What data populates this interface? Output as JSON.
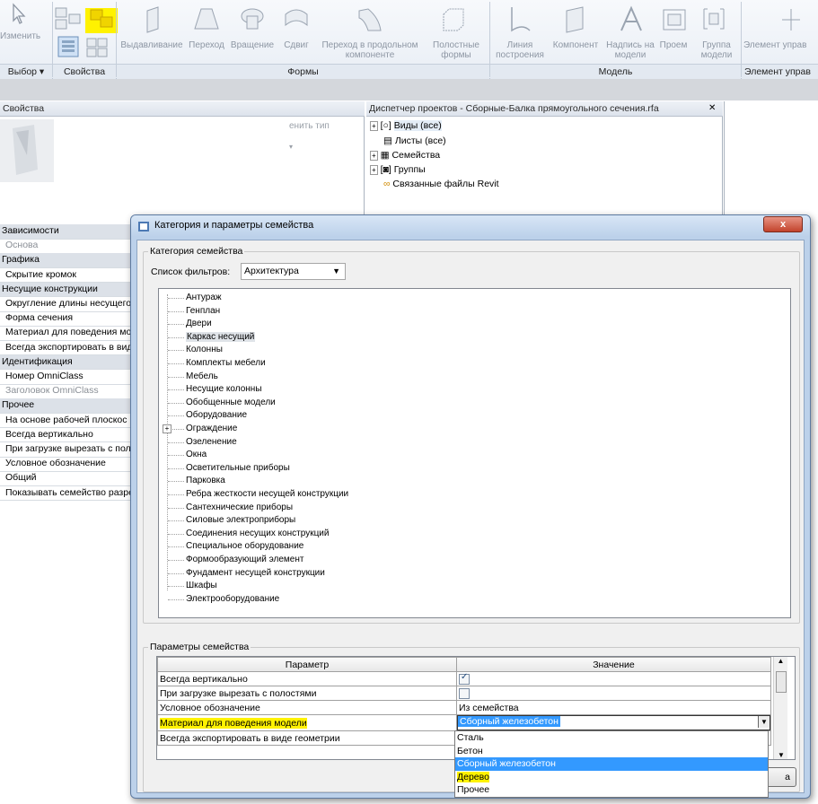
{
  "ribbon": {
    "modify_label": "Изменить",
    "select_label": "Выбор",
    "properties_label": "Свойства",
    "forms_panel": "Формы",
    "model_panel": "Модель",
    "control_panel": "Элемент управ",
    "tools": [
      {
        "label": "Выдавливание"
      },
      {
        "label": "Переход"
      },
      {
        "label": "Вращение"
      },
      {
        "label": "Сдвиг"
      },
      {
        "label": "Переход в продольном компоненте"
      },
      {
        "label": "Полостные формы"
      },
      {
        "label": "Линия построения"
      },
      {
        "label": "Компонент"
      },
      {
        "label": "Надпись на модели"
      },
      {
        "label": "Проем"
      },
      {
        "label": "Группа модели"
      },
      {
        "label": "Элемент управ"
      }
    ]
  },
  "properties": {
    "title": "Свойства",
    "change_type": "енить тип",
    "rows": [
      {
        "text": "Зависимости",
        "kind": "cat"
      },
      {
        "text": "Основа",
        "kind": "dis"
      },
      {
        "text": "Графика",
        "kind": "cat"
      },
      {
        "text": "Скрытие кромок",
        "kind": "row"
      },
      {
        "text": "Несущие конструкции",
        "kind": "cat"
      },
      {
        "text": "Округление длины несущего",
        "kind": "row"
      },
      {
        "text": "Форма сечения",
        "kind": "row"
      },
      {
        "text": "Материал для поведения мо",
        "kind": "row"
      },
      {
        "text": "Всегда экспортировать в вид",
        "kind": "row"
      },
      {
        "text": "Идентификация",
        "kind": "cat"
      },
      {
        "text": "Номер OmniClass",
        "kind": "row"
      },
      {
        "text": "Заголовок OmniClass",
        "kind": "dis"
      },
      {
        "text": "Прочее",
        "kind": "cat"
      },
      {
        "text": "На основе рабочей плоскос",
        "kind": "row"
      },
      {
        "text": "Всегда вертикально",
        "kind": "row"
      },
      {
        "text": "При загрузке вырезать с пол",
        "kind": "row"
      },
      {
        "text": "Условное обозначение",
        "kind": "row"
      },
      {
        "text": "Общий",
        "kind": "row"
      },
      {
        "text": "Показывать семейство разре",
        "kind": "row"
      }
    ]
  },
  "project_browser": {
    "title": "Диспетчер проектов - Сборные-Балка прямоугольного сечения.rfa",
    "close": "✕",
    "items": [
      "Виды (все)",
      "Листы (все)",
      "Семейства",
      "Группы",
      "Связанные файлы Revit"
    ]
  },
  "dialog": {
    "title": "Категория и параметры семейства",
    "close": "x",
    "category_group": "Категория семейства",
    "filter_label": "Список фильтров:",
    "filter_value": "Архитектура",
    "categories": [
      "Антураж",
      "Генплан",
      "Двери",
      "Каркас несущий",
      "Колонны",
      "Комплекты мебели",
      "Мебель",
      "Несущие колонны",
      "Обобщенные модели",
      "Оборудование",
      "Ограждение",
      "Озеленение",
      "Окна",
      "Осветительные приборы",
      "Парковка",
      "Ребра жесткости несущей конструкции",
      "Сантехнические приборы",
      "Силовые электроприборы",
      "Соединения несущих конструкций",
      "Специальное оборудование",
      "Формообразующий элемент",
      "Фундамент несущей конструкции",
      "Шкафы",
      "Электрооборудование"
    ],
    "selected_category": "Каркас несущий",
    "params_group": "Параметры семейства",
    "col_param": "Параметр",
    "col_value": "Значение",
    "params": [
      {
        "name": "Всегда вертикально",
        "value": "",
        "checked": true
      },
      {
        "name": "При загрузке вырезать с полостями",
        "value": "",
        "checked": false
      },
      {
        "name": "Условное обозначение",
        "value": "Из семейства"
      },
      {
        "name": "Материал для поведения модели",
        "value": "Сборный железобетон"
      },
      {
        "name": "Всегда экспортировать в виде геометрии",
        "value": ""
      }
    ],
    "dropdown_options": [
      "Сталь",
      "Бетон",
      "Сборный железобетон",
      "Дерево",
      "Прочее"
    ],
    "dropdown_selected": "Сборный железобетон",
    "button_tail": "а"
  },
  "colors": {
    "highlight": "#fff200",
    "selection": "#3399ff",
    "dialog_frame": "#bcd1ea"
  }
}
